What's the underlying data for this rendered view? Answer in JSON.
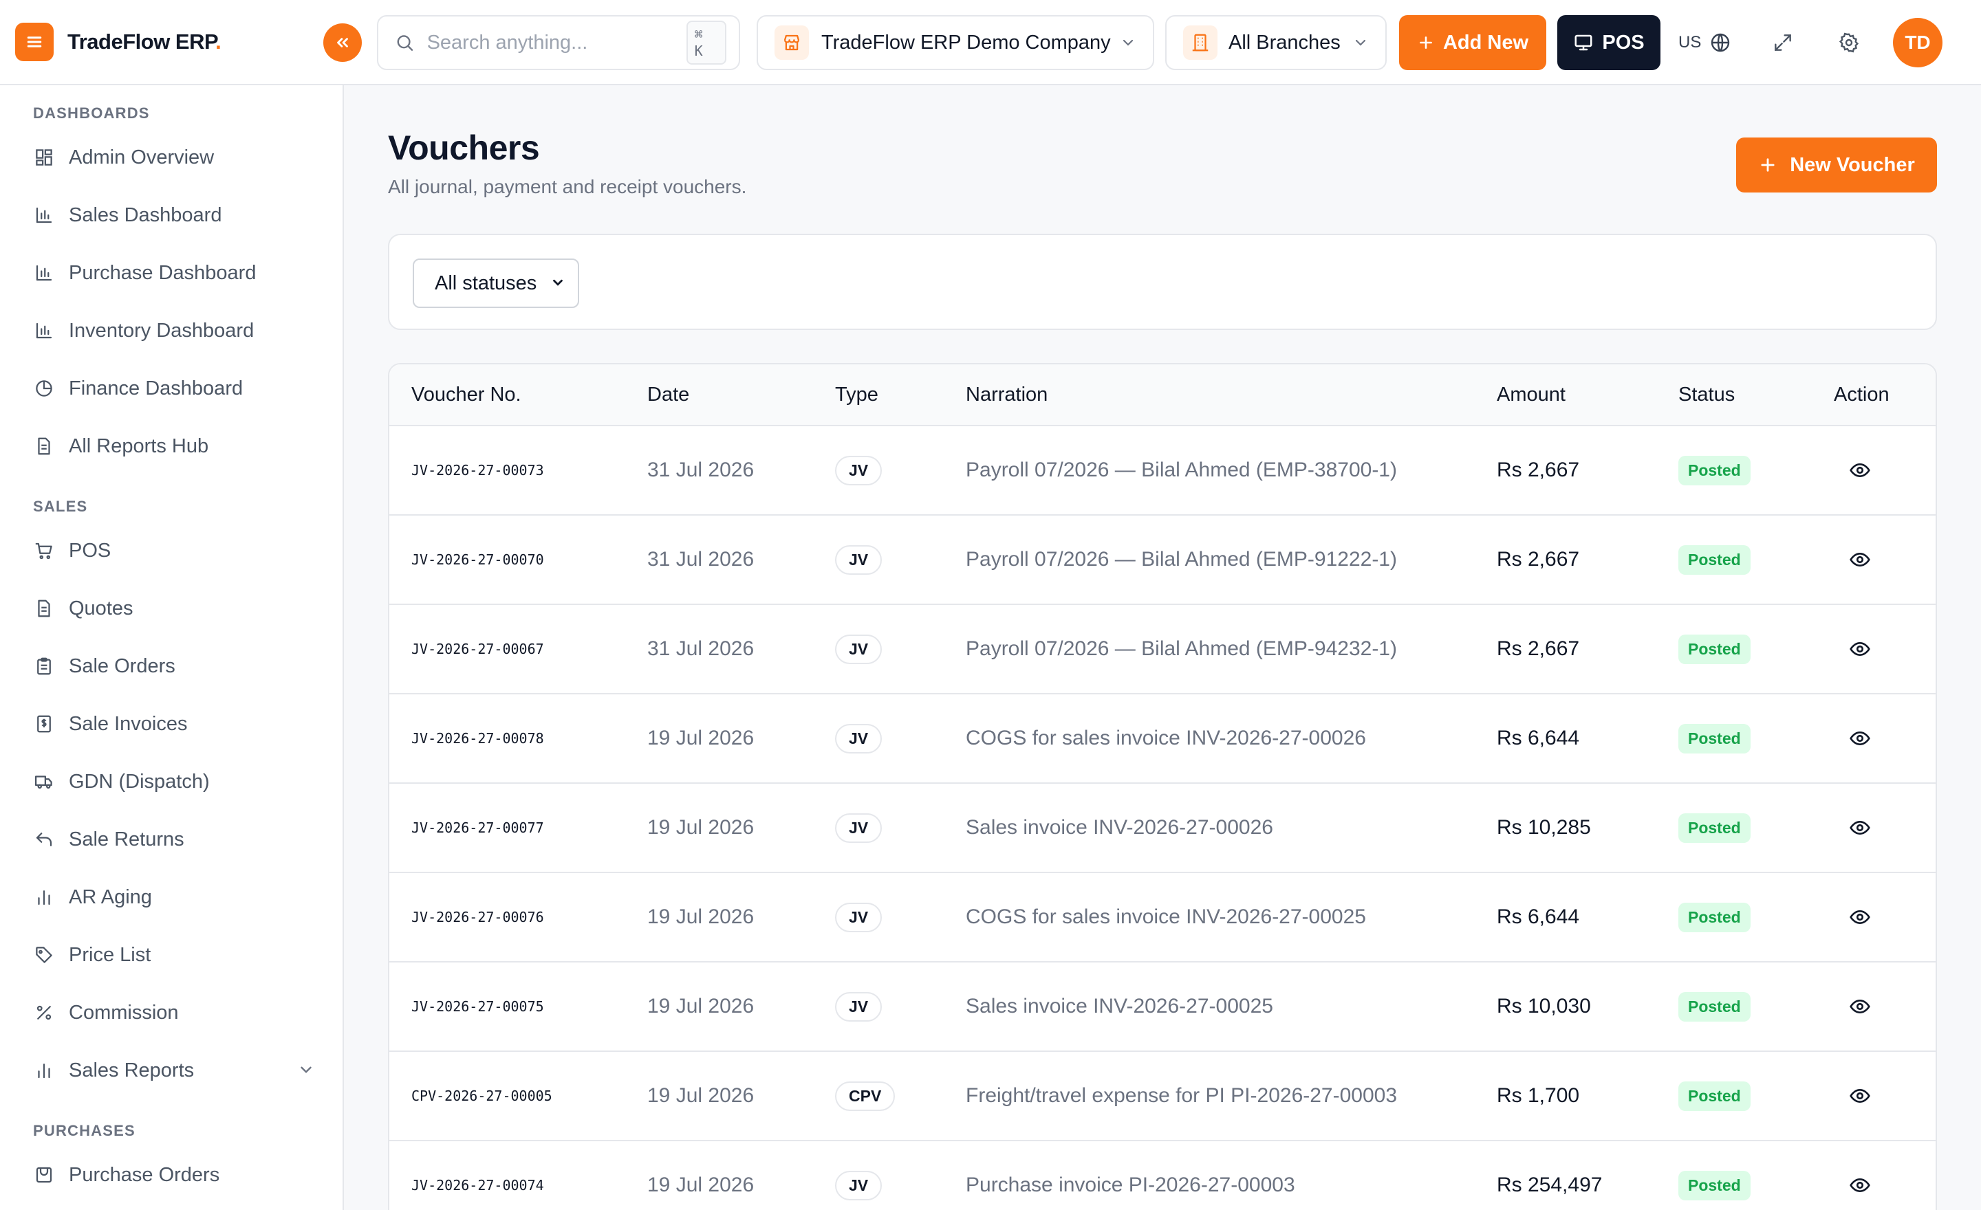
{
  "app": {
    "brand_name": "TradeFlow ERP",
    "brand_dot": ".",
    "accent_color": "#f97316"
  },
  "topbar": {
    "search_placeholder": "Search anything...",
    "search_shortcut": "⌘ K",
    "company": "TradeFlow ERP Demo Company",
    "branches": "All Branches",
    "add_new_label": "Add New",
    "pos_label": "POS",
    "language": "US",
    "avatar_initials": "TD"
  },
  "sidebar": {
    "sections": [
      {
        "title": "DASHBOARDS",
        "items": [
          {
            "label": "Admin Overview",
            "icon": "grid-icon"
          },
          {
            "label": "Sales Dashboard",
            "icon": "bar-chart-icon"
          },
          {
            "label": "Purchase Dashboard",
            "icon": "bar-chart-icon"
          },
          {
            "label": "Inventory Dashboard",
            "icon": "bar-chart-icon"
          },
          {
            "label": "Finance Dashboard",
            "icon": "pie-chart-icon"
          },
          {
            "label": "All Reports Hub",
            "icon": "document-icon"
          }
        ]
      },
      {
        "title": "SALES",
        "items": [
          {
            "label": "POS",
            "icon": "cart-icon"
          },
          {
            "label": "Quotes",
            "icon": "document-icon"
          },
          {
            "label": "Sale Orders",
            "icon": "clipboard-icon"
          },
          {
            "label": "Sale Invoices",
            "icon": "invoice-icon"
          },
          {
            "label": "GDN (Dispatch)",
            "icon": "truck-icon"
          },
          {
            "label": "Sale Returns",
            "icon": "undo-icon"
          },
          {
            "label": "AR Aging",
            "icon": "bar-chart-icon"
          },
          {
            "label": "Price List",
            "icon": "tag-icon"
          },
          {
            "label": "Commission",
            "icon": "percent-icon"
          },
          {
            "label": "Sales Reports",
            "icon": "bar-chart-icon"
          }
        ]
      },
      {
        "title": "PURCHASES",
        "items": [
          {
            "label": "Purchase Orders",
            "icon": "box-icon"
          }
        ]
      }
    ]
  },
  "page": {
    "title": "Vouchers",
    "subtitle": "All journal, payment and receipt vouchers.",
    "new_voucher_label": "New Voucher",
    "status_filter": {
      "selected": "All statuses",
      "options": [
        "All statuses"
      ]
    }
  },
  "table": {
    "columns": [
      "Voucher No.",
      "Date",
      "Type",
      "Narration",
      "Amount",
      "Status",
      "Action"
    ],
    "rows": [
      {
        "voucher_no": "JV-2026-27-00073",
        "date": "31 Jul 2026",
        "type": "JV",
        "narration": "Payroll 07/2026 — Bilal Ahmed (EMP-38700-1)",
        "amount": "Rs 2,667",
        "status": "Posted"
      },
      {
        "voucher_no": "JV-2026-27-00070",
        "date": "31 Jul 2026",
        "type": "JV",
        "narration": "Payroll 07/2026 — Bilal Ahmed (EMP-91222-1)",
        "amount": "Rs 2,667",
        "status": "Posted"
      },
      {
        "voucher_no": "JV-2026-27-00067",
        "date": "31 Jul 2026",
        "type": "JV",
        "narration": "Payroll 07/2026 — Bilal Ahmed (EMP-94232-1)",
        "amount": "Rs 2,667",
        "status": "Posted"
      },
      {
        "voucher_no": "JV-2026-27-00078",
        "date": "19 Jul 2026",
        "type": "JV",
        "narration": "COGS for sales invoice INV-2026-27-00026",
        "amount": "Rs 6,644",
        "status": "Posted"
      },
      {
        "voucher_no": "JV-2026-27-00077",
        "date": "19 Jul 2026",
        "type": "JV",
        "narration": "Sales invoice INV-2026-27-00026",
        "amount": "Rs 10,285",
        "status": "Posted"
      },
      {
        "voucher_no": "JV-2026-27-00076",
        "date": "19 Jul 2026",
        "type": "JV",
        "narration": "COGS for sales invoice INV-2026-27-00025",
        "amount": "Rs 6,644",
        "status": "Posted"
      },
      {
        "voucher_no": "JV-2026-27-00075",
        "date": "19 Jul 2026",
        "type": "JV",
        "narration": "Sales invoice INV-2026-27-00025",
        "amount": "Rs 10,030",
        "status": "Posted"
      },
      {
        "voucher_no": "CPV-2026-27-00005",
        "date": "19 Jul 2026",
        "type": "CPV",
        "narration": "Freight/travel expense for PI PI-2026-27-00003",
        "amount": "Rs 1,700",
        "status": "Posted"
      },
      {
        "voucher_no": "JV-2026-27-00074",
        "date": "19 Jul 2026",
        "type": "JV",
        "narration": "Purchase invoice PI-2026-27-00003",
        "amount": "Rs 254,497",
        "status": "Posted"
      }
    ]
  }
}
